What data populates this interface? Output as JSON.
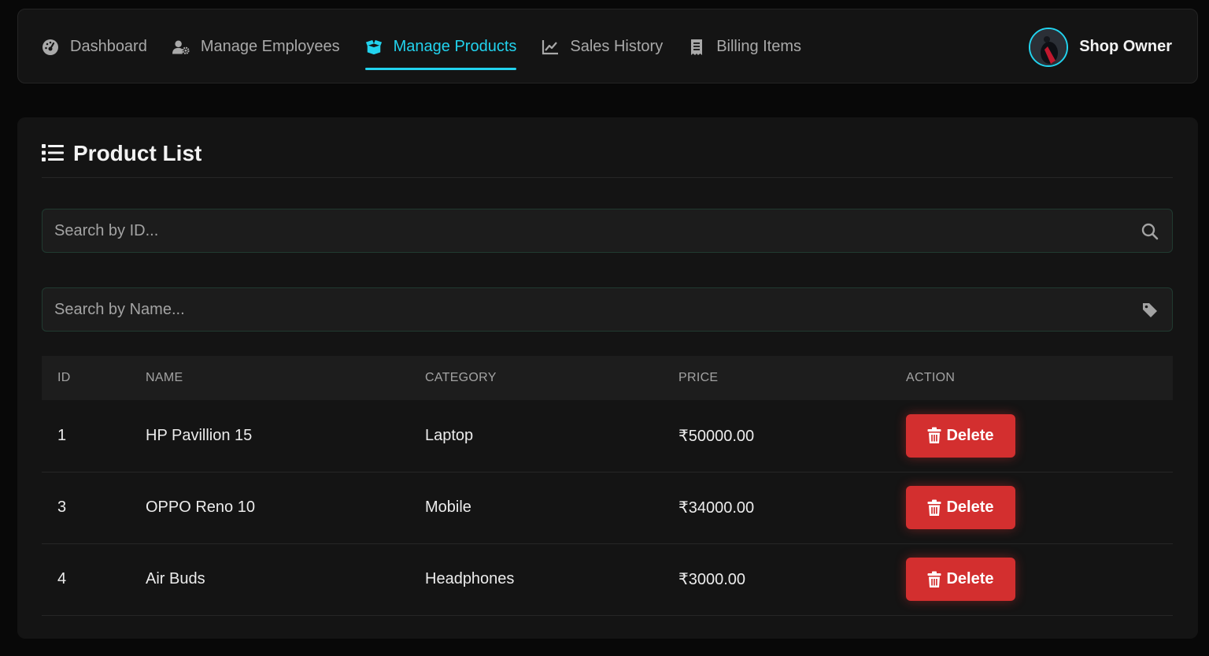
{
  "nav": {
    "items": [
      {
        "label": "Dashboard",
        "icon": "dashboard-gauge-icon",
        "active": false
      },
      {
        "label": "Manage Employees",
        "icon": "user-gear-icon",
        "active": false
      },
      {
        "label": "Manage Products",
        "icon": "box-open-icon",
        "active": true
      },
      {
        "label": "Sales History",
        "icon": "line-chart-icon",
        "active": false
      },
      {
        "label": "Billing Items",
        "icon": "receipt-icon",
        "active": false
      }
    ],
    "user_name": "Shop Owner",
    "accent_color": "#22d3ee"
  },
  "product_list": {
    "title": "Product List",
    "search_id_placeholder": "Search by ID...",
    "search_name_placeholder": "Search by Name...",
    "columns": [
      "ID",
      "NAME",
      "CATEGORY",
      "PRICE",
      "ACTION"
    ],
    "rows": [
      {
        "id": "1",
        "name": "HP Pavillion 15",
        "category": "Laptop",
        "price": "₹50000.00",
        "action": "Delete"
      },
      {
        "id": "3",
        "name": "OPPO Reno 10",
        "category": "Mobile",
        "price": "₹34000.00",
        "action": "Delete"
      },
      {
        "id": "4",
        "name": "Air Buds",
        "category": "Headphones",
        "price": "₹3000.00",
        "action": "Delete"
      }
    ],
    "delete_color": "#d32f2f"
  }
}
